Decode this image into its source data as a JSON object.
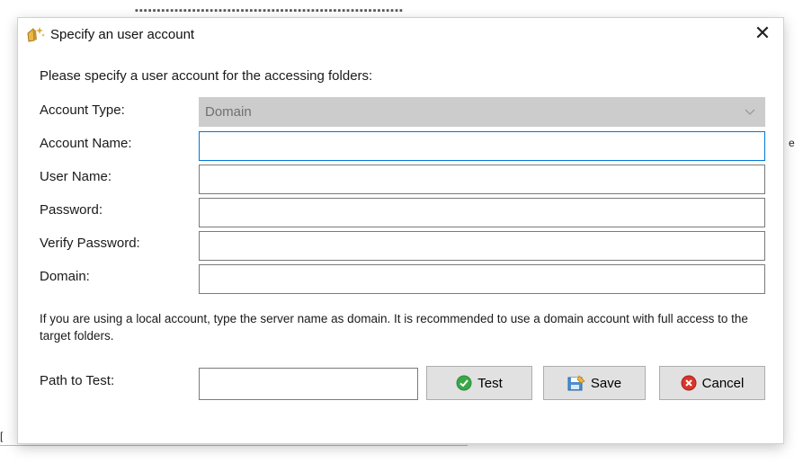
{
  "dialog": {
    "title": "Specify an user account",
    "close_glyph": "✕",
    "prompt": "Please specify a user account for the accessing folders:",
    "fields": {
      "account_type": {
        "label": "Account Type:",
        "value": "Domain",
        "disabled": true
      },
      "account_name": {
        "label": "Account Name:",
        "value": ""
      },
      "user_name": {
        "label": "User Name:",
        "value": ""
      },
      "password": {
        "label": "Password:",
        "value": ""
      },
      "verify_password": {
        "label": "Verify Password:",
        "value": ""
      },
      "domain": {
        "label": "Domain:",
        "value": ""
      }
    },
    "note": "If you are using a local account, type the server name as domain. It is recommended to use a domain account with full access to the target folders.",
    "path_to_test": {
      "label": "Path to Test:",
      "value": ""
    },
    "buttons": {
      "test": "Test",
      "save": "Save",
      "cancel": "Cancel"
    }
  },
  "icons": {
    "app": "app-logo-icon",
    "close": "close-icon",
    "chevron": "chevron-down-icon",
    "test": "check-circle-icon",
    "save": "save-icon",
    "cancel": "cancel-circle-icon"
  },
  "colors": {
    "focus_border": "#0078d7",
    "disabled_bg": "#cccccc",
    "button_bg": "#e1e1e1",
    "test_green": "#3aa84a",
    "cancel_red": "#d9352b"
  }
}
